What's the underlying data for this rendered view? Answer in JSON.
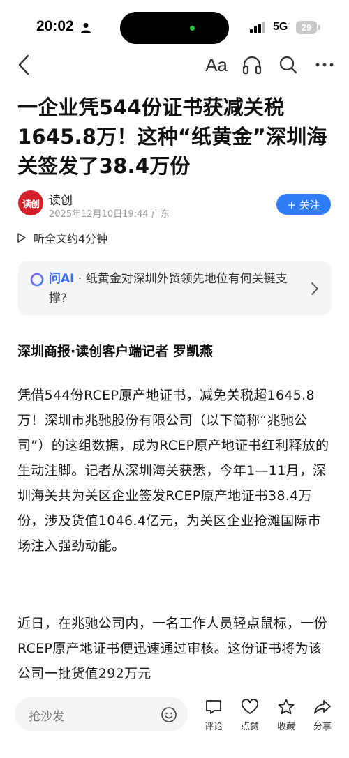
{
  "status_bar": {
    "time": "20:02",
    "network": "5G",
    "battery": "29"
  },
  "nav": {
    "font_label": "Aa",
    "icons": [
      "back-icon",
      "font-size-icon",
      "headphones-icon",
      "search-icon",
      "more-icon"
    ]
  },
  "article": {
    "title": "一企业凭544份证书获减关税1645.8万！这种“纸黄金”深圳海关签发了38.4万份",
    "author": {
      "logo_text": "读创",
      "name": "读创",
      "meta": "2025年12月10日19:44 广东"
    },
    "follow_label": "+ 关注",
    "listen_label": "听全文约4分钟",
    "ai": {
      "label": "问AI",
      "separator": " · ",
      "question": "纸黄金对深圳外贸领先地位有何关键支撑?"
    },
    "byline": "深圳商报·读创客户端记者 罗凯燕",
    "paragraphs": [
      "凭借544份RCEP原产地证书，减免关税超1645.8万！深圳市兆驰股份有限公司（以下简称“兆驰公司”）的这组数据，成为RCEP原产地证书红利释放的生动注脚。记者从深圳海关获悉，今年1—11月，深圳海关共为关区企业签发RCEP原产地证书38.4万份，涉及货值1046.4亿元，为关区企业抢滩国际市场注入强劲动能。",
      "近日，在兆驰公司内，一名工作人员轻点鼠标，一份RCEP原产地证书便迅速通过审核。这份证书将为该公司一批货值292万元"
    ]
  },
  "bottom_bar": {
    "comment_placeholder": "抢沙发",
    "actions": [
      {
        "label": "评论",
        "icon": "comment-icon"
      },
      {
        "label": "点赞",
        "icon": "like-icon"
      },
      {
        "label": "收藏",
        "icon": "favorite-icon"
      },
      {
        "label": "分享",
        "icon": "share-icon"
      }
    ]
  },
  "colors": {
    "accent": "#2f7df6",
    "ai_label": "#3b6cf6",
    "logo": "#d3202b"
  }
}
